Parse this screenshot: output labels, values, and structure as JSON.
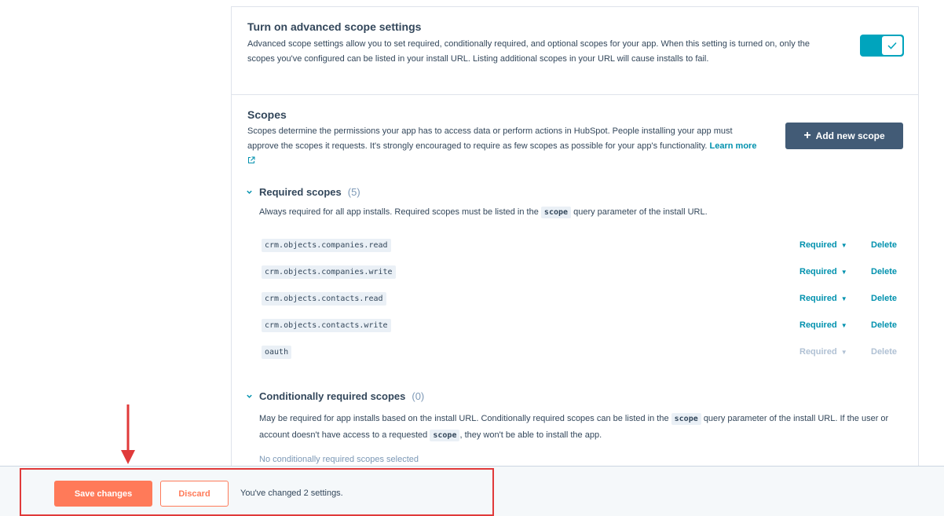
{
  "advanced": {
    "title": "Turn on advanced scope settings",
    "description": "Advanced scope settings allow you to set required, conditionally required, and optional scopes for your app. When this setting is turned on, only the scopes you've configured can be listed in your install URL. Listing additional scopes in your URL will cause installs to fail.",
    "toggle_on": true
  },
  "scopes": {
    "title": "Scopes",
    "description": "Scopes determine the permissions your app has to access data or perform actions in HubSpot. People installing your app must approve the scopes it requests. It's strongly encouraged to require as few scopes as possible for your app's functionality.",
    "learn_more": "Learn more",
    "add_button": "Add new scope"
  },
  "required": {
    "title": "Required scopes",
    "count": "(5)",
    "desc_before": "Always required for all app installs. Required scopes must be listed in the",
    "desc_code": "scope",
    "desc_after": "query parameter of the install URL.",
    "items": [
      {
        "name": "crm.objects.companies.read",
        "level": "Required",
        "delete": "Delete"
      },
      {
        "name": "crm.objects.companies.write",
        "level": "Required",
        "delete": "Delete"
      },
      {
        "name": "crm.objects.contacts.read",
        "level": "Required",
        "delete": "Delete"
      },
      {
        "name": "crm.objects.contacts.write",
        "level": "Required",
        "delete": "Delete"
      },
      {
        "name": "oauth",
        "level": "Required",
        "delete": "Delete"
      }
    ]
  },
  "conditional": {
    "title": "Conditionally required scopes",
    "count": "(0)",
    "desc_1": "May be required for app installs based on the install URL. Conditionally required scopes can be listed in the",
    "desc_code_1": "scope",
    "desc_2": "query parameter of the install URL. If the user or account doesn't have access to a requested",
    "desc_code_2": "scope",
    "desc_3": ", they won't be able to install the app.",
    "empty": "No conditionally required scopes selected"
  },
  "footer": {
    "save": "Save changes",
    "discard": "Discard",
    "status": "You've changed 2 settings."
  },
  "colors": {
    "accent": "#00a4bd",
    "primary_button": "#ff7a59",
    "annotation": "#e03a3a"
  }
}
